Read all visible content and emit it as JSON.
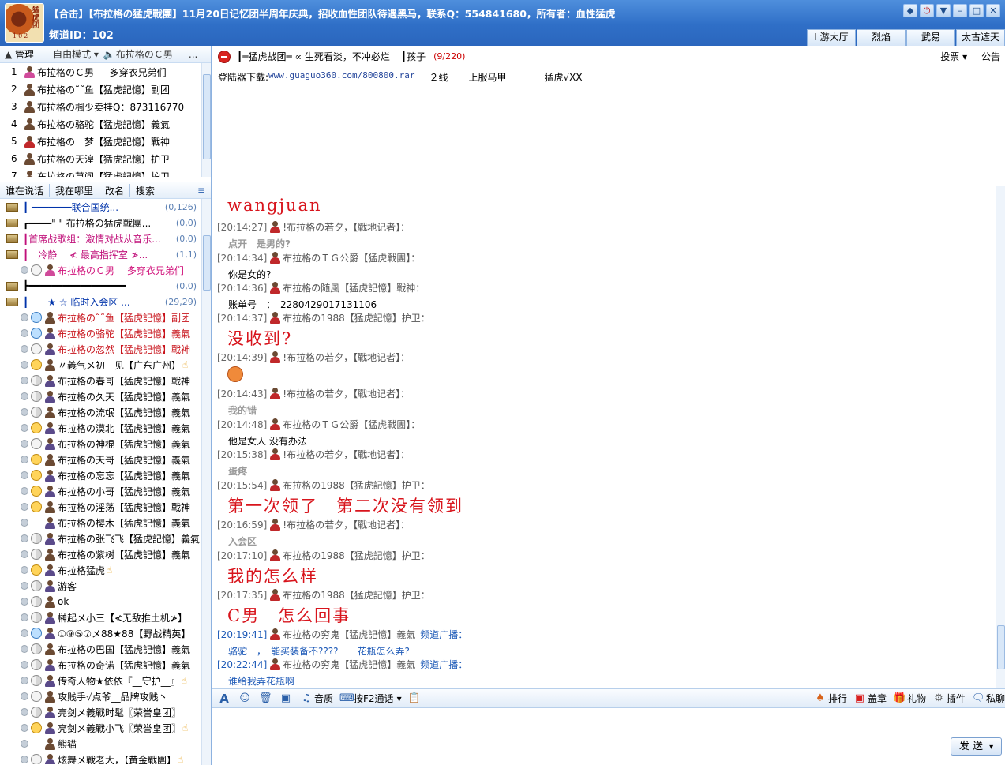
{
  "title": {
    "text": "【合击】【布拉格の猛虎戰團】11月20日记忆团半周年庆典，招收血性团队待遇黑马，联系Q：554841680，所有者：血性猛虎",
    "channel_id": "频道ID：102",
    "logo_text": "猛虎团",
    "logo_num": "102"
  },
  "top_tabs": [
    "游大厅",
    "烈焰",
    "武易",
    "太古遮天"
  ],
  "manager_bar": {
    "manage": "管理",
    "mode": "自由模式",
    "speaker": "布拉格のＣ男",
    "more": "..."
  },
  "managers": [
    {
      "n": "1",
      "name": "布拉格のＣ男 　 多穿衣兄弟们"
    },
    {
      "n": "2",
      "name": "布拉格の˜˜鱼【猛虎記憶】副团"
    },
    {
      "n": "3",
      "name": "布拉格の楓少卖挂Q：873116770"
    },
    {
      "n": "4",
      "name": "布拉格の骆驼【猛虎記憶】義氣"
    },
    {
      "n": "5",
      "name": "布拉格の　梦【猛虎記憶】戰神"
    },
    {
      "n": "6",
      "name": "布拉格の天湟【猛虎記憶】护卫"
    },
    {
      "n": "7",
      "name": "布拉格の莫问【猛虎記憶】护卫"
    }
  ],
  "search_bar": [
    "谁在说话",
    "我在哪里",
    "改名",
    "搜索"
  ],
  "groups": [
    {
      "label": "┃ ━━━━━━━联合国统...",
      "count": "(0,126)"
    },
    {
      "label": "┏━━━━\" \" 布拉格の猛虎戰團...",
      "count": "(0,0)"
    },
    {
      "label": "┃首席战歌组：激情对战从音乐...",
      "count": "(0,0)"
    },
    {
      "label": "┃　冷静　 ≮ 最高指挥室 ≯...",
      "count": "(1,1)"
    },
    {
      "label": "┣━━━━━━━━━━━━━━━━━",
      "count": "(0,0)"
    },
    {
      "label": "┃　　★ ☆ 临时入会区 ...",
      "count": "(29,29)"
    }
  ],
  "commander_user": "布拉格のＣ男　 多穿衣兄弟们",
  "users": [
    "布拉格の˜˜鱼【猛虎記憶】副团",
    "布拉格の骆驼【猛虎記憶】義氣",
    "布拉格の忽然【猛虎記憶】戰神",
    "〃義气メ初　见【广东广州】",
    "布拉格の春哥【猛虎記憶】戰神",
    "布拉格の久天【猛虎記憶】義氣",
    "布拉格の流氓【猛虎記憶】義氣",
    "布拉格の漠北【猛虎記憶】義氣",
    "布拉格の神棍【猛虎記憶】義氣",
    "布拉格の天哥【猛虎記憶】義氣",
    "布拉格の忘忘【猛虎記憶】義氣",
    "布拉格の小哥【猛虎記憶】義氣",
    "布拉格の淫荡【猛虎記憶】戰神",
    "布拉格の樱木【猛虎記憶】義氣",
    "布拉格の张飞飞【猛虎記憶】義氣",
    "布拉格の紫树【猛虎記憶】義氣",
    "布拉格猛虎",
    "游客",
    "ok",
    "榊起メ小三【≮无敌推土机≯】",
    "①⑨⑤⑦メ88★88【野战精英】",
    "布拉格の巴国【猛虎記憶】義氣",
    "布拉格の奇诺【猛虎記憶】義氣",
    "传奇人物★依依『__守护__』",
    "攻贱手√点爷__品牌攻贱丶",
    "亮剑メ義戰时髦〖荣誉皇团〗",
    "亮剑メ義戰小飞〖荣誉皇团〗",
    "熊猫",
    "炫舞メ戰老大，【黄金戰團】"
  ],
  "notice": {
    "name": "┃═猛虎战团═ ∝ 生死看淡，不冲必烂",
    "child": "┃孩子",
    "count": "(9/220)",
    "vote": "投票",
    "announce": "公告",
    "download_label": "登陆器下载:",
    "download_url": "www.guaguo360.com/800800.rar",
    "line": "２线",
    "server": "上服马甲",
    "tiger": "猛虎√ΧΧ"
  },
  "messages": [
    {
      "ts": "",
      "who": "",
      "body": "wangjuan",
      "style": "big"
    },
    {
      "ts": "[20:14:27]",
      "who": "!布拉格の若夕，【戰地记者】：",
      "body": "点开　是男的?",
      "style": "gray"
    },
    {
      "ts": "[20:14:34]",
      "who": "布拉格のＴＧ公爵【猛虎戰團】：",
      "body": "你是女的?",
      "style": "black"
    },
    {
      "ts": "[20:14:36]",
      "who": "布拉格の随風【猛虎記憶】戰神：",
      "body": "账单号　：　2280429017131106",
      "style": "black"
    },
    {
      "ts": "[20:14:37]",
      "who": "布拉格の1988【猛虎記憶】护卫：",
      "body": "没收到?",
      "style": "big"
    },
    {
      "ts": "[20:14:39]",
      "who": "!布拉格の若夕，【戰地记者】：",
      "body": "",
      "style": "smiley"
    },
    {
      "ts": "[20:14:43]",
      "who": "!布拉格の若夕，【戰地记者】：",
      "body": "我的错",
      "style": "gray"
    },
    {
      "ts": "[20:14:48]",
      "who": "布拉格のＴＧ公爵【猛虎戰團】：",
      "body": "他是女人 没有办法",
      "style": "black"
    },
    {
      "ts": "[20:15:38]",
      "who": "!布拉格の若夕，【戰地记者】：",
      "body": "蛋疼",
      "style": "gray"
    },
    {
      "ts": "[20:15:54]",
      "who": "布拉格の1988【猛虎記憶】护卫：",
      "body": "第一次领了　第二次没有领到",
      "style": "big"
    },
    {
      "ts": "[20:16:59]",
      "who": "!布拉格の若夕，【戰地记者】：",
      "body": "入会区",
      "style": "gray"
    },
    {
      "ts": "[20:17:10]",
      "who": "布拉格の1988【猛虎記憶】护卫：",
      "body": "我的怎么样",
      "style": "big"
    },
    {
      "ts": "[20:17:35]",
      "who": "布拉格の1988【猛虎記憶】护卫：",
      "body": "C男　怎么回事",
      "style": "big"
    },
    {
      "ts": "[20:19:41]",
      "who": "布拉格の穷鬼【猛虎記憶】義氣",
      "body": "骆驼　，　能买装备不????　　花瓶怎么弄?",
      "style": "blue",
      "broadcast": "频道广播："
    },
    {
      "ts": "[20:22:44]",
      "who": "布拉格の穷鬼【猛虎記憶】義氣",
      "body": "谁给我弄花瓶啊",
      "style": "blue",
      "broadcast": "频道广播："
    }
  ],
  "toolbar": {
    "quality": "音质",
    "talk": "按F2通话",
    "rank": "排行",
    "stamp": "盖章",
    "gift": "礼物",
    "plugin": "插件",
    "private": "私聊"
  },
  "send": "发 送"
}
